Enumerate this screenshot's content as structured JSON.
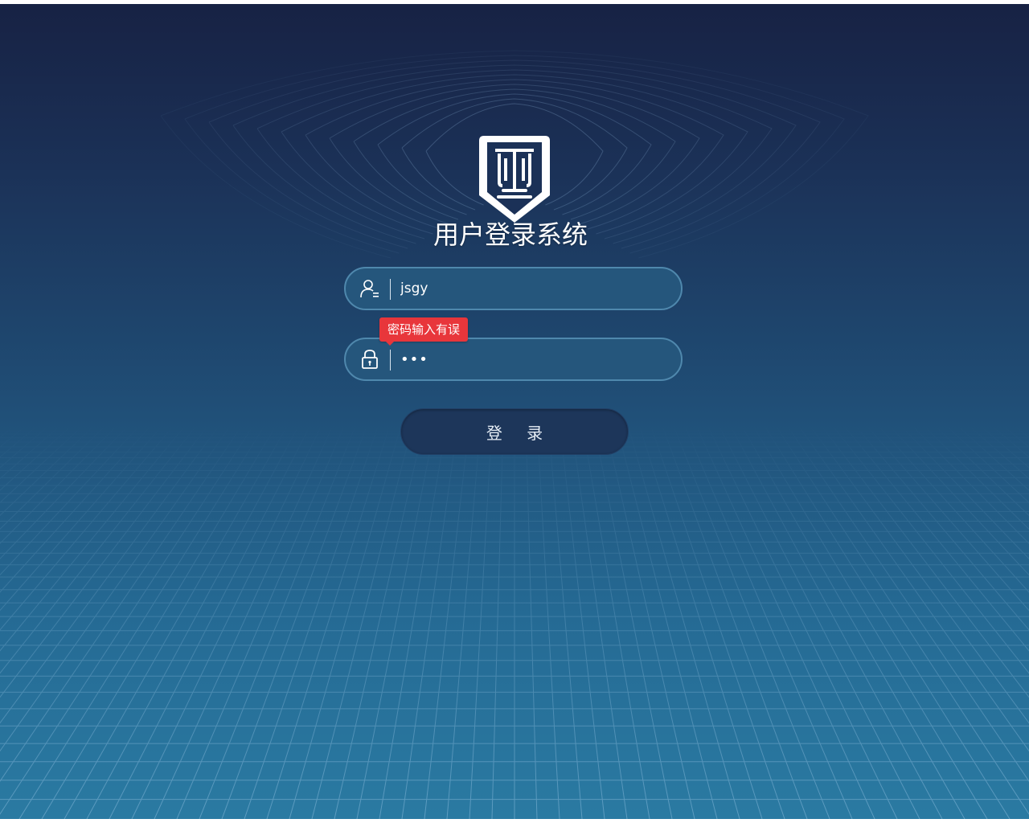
{
  "page": {
    "title": "用户登录系统"
  },
  "form": {
    "username": {
      "value": "jsgy",
      "icon": "user-icon"
    },
    "password": {
      "value": "•••",
      "icon": "lock-icon"
    },
    "error_tooltip": "密码输入有误",
    "login_label": "登 录"
  },
  "logo": {
    "icon": "scales-shield-logo"
  },
  "colors": {
    "background_top": "#172244",
    "background_bottom": "#2a7aa2",
    "field_fill": "#25567c",
    "field_border": "#4f88ad",
    "error": "#e8363b",
    "button_fill": "#1d365a"
  }
}
